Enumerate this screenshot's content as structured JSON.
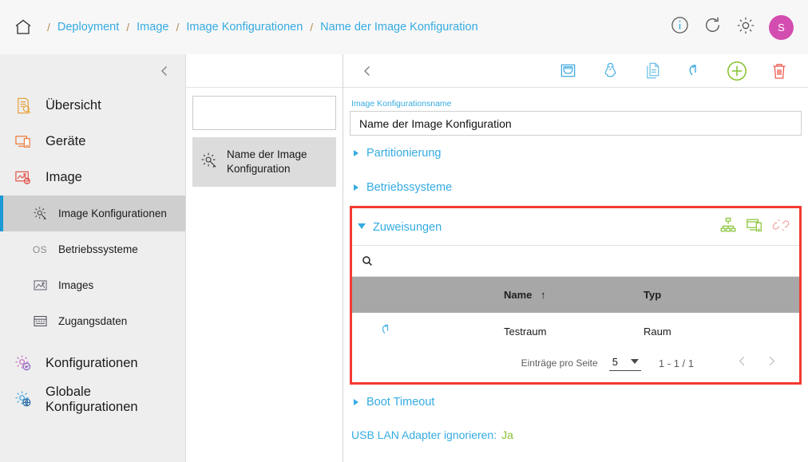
{
  "colors": {
    "link": "#35abe2",
    "highlight_border": "#f43b31",
    "accent_green": "#86c232",
    "avatar": "#d34db0",
    "active_rail": "#1b9ad6"
  },
  "topbar": {
    "home_icon": "home-icon",
    "separator": "/",
    "breadcrumbs": [
      {
        "label": "Deployment"
      },
      {
        "label": "Image"
      },
      {
        "label": "Image Konfigurationen"
      },
      {
        "label": "Name der Image Konfiguration"
      }
    ],
    "actions": [
      {
        "name": "info-icon",
        "label": "i"
      },
      {
        "name": "refresh-icon",
        "label": ""
      },
      {
        "name": "gear-icon",
        "label": ""
      }
    ],
    "avatar_initial": "S"
  },
  "sidebar": {
    "collapse_icon": "chevron-left-icon",
    "items": [
      {
        "label": "Übersicht",
        "icon": "overview-icon",
        "type": "top"
      },
      {
        "label": "Geräte",
        "icon": "devices-icon",
        "type": "top"
      },
      {
        "label": "Image",
        "icon": "image-icon",
        "type": "top"
      },
      {
        "label": "Image Konfigurationen",
        "icon": "image-config-icon",
        "type": "sub",
        "active": true
      },
      {
        "label": "Betriebssysteme",
        "icon": "os-icon",
        "icon_text": "OS",
        "type": "sub",
        "active": false
      },
      {
        "label": "Images",
        "icon": "images-icon",
        "type": "sub",
        "active": false
      },
      {
        "label": "Zugangsdaten",
        "icon": "credentials-icon",
        "type": "sub",
        "active": false
      },
      {
        "label": "Konfigurationen",
        "icon": "configurations-icon",
        "type": "top"
      },
      {
        "label": "Globale Konfigurationen",
        "icon": "global-configurations-icon",
        "type": "top"
      }
    ]
  },
  "list_panel": {
    "search": {
      "value": "",
      "placeholder": "",
      "icon": "search-icon"
    },
    "items": [
      {
        "label": "Name der Image Konfiguration",
        "icon": "image-config-icon",
        "selected": true
      }
    ]
  },
  "main": {
    "toolbar": {
      "back_icon": "chevron-left-icon",
      "buttons": [
        {
          "name": "network-port-icon",
          "title": ""
        },
        {
          "name": "linux-penguin-icon",
          "title": ""
        },
        {
          "name": "copy-document-icon",
          "title": ""
        },
        {
          "name": "undo-icon",
          "title": ""
        },
        {
          "name": "add-plus-icon",
          "title": ""
        },
        {
          "name": "delete-trash-icon",
          "title": ""
        }
      ]
    },
    "name_field": {
      "label": "Image Konfigurationsname",
      "value": "Name der Image Konfiguration"
    },
    "accordions": [
      {
        "label": "Partitionierung",
        "open": false
      },
      {
        "label": "Betriebssysteme",
        "open": false
      }
    ],
    "assignments": {
      "title": "Zuweisungen",
      "open": true,
      "header_icons": [
        {
          "name": "org-chart-icon"
        },
        {
          "name": "device-group-icon"
        },
        {
          "name": "unlink-icon"
        }
      ],
      "search": {
        "value": "",
        "placeholder": "",
        "icon": "search-icon"
      },
      "table": {
        "columns": [
          "",
          "Name",
          "Typ"
        ],
        "sort_column": "Name",
        "sort_direction": "↑",
        "rows": [
          {
            "icon": "inherited-arrow-icon",
            "name": "Testraum",
            "typ": "Raum"
          }
        ]
      },
      "pagination": {
        "per_page_label": "Einträge pro Seite",
        "per_page_value": "5",
        "range": "1 - 1 / 1",
        "prev_icon": "chevron-left-icon",
        "next_icon": "chevron-right-icon"
      }
    },
    "boot_timeout": {
      "label": "Boot Timeout",
      "open": false
    },
    "usb_lan": {
      "label": "USB LAN Adapter ignorieren:",
      "value": "Ja"
    }
  }
}
